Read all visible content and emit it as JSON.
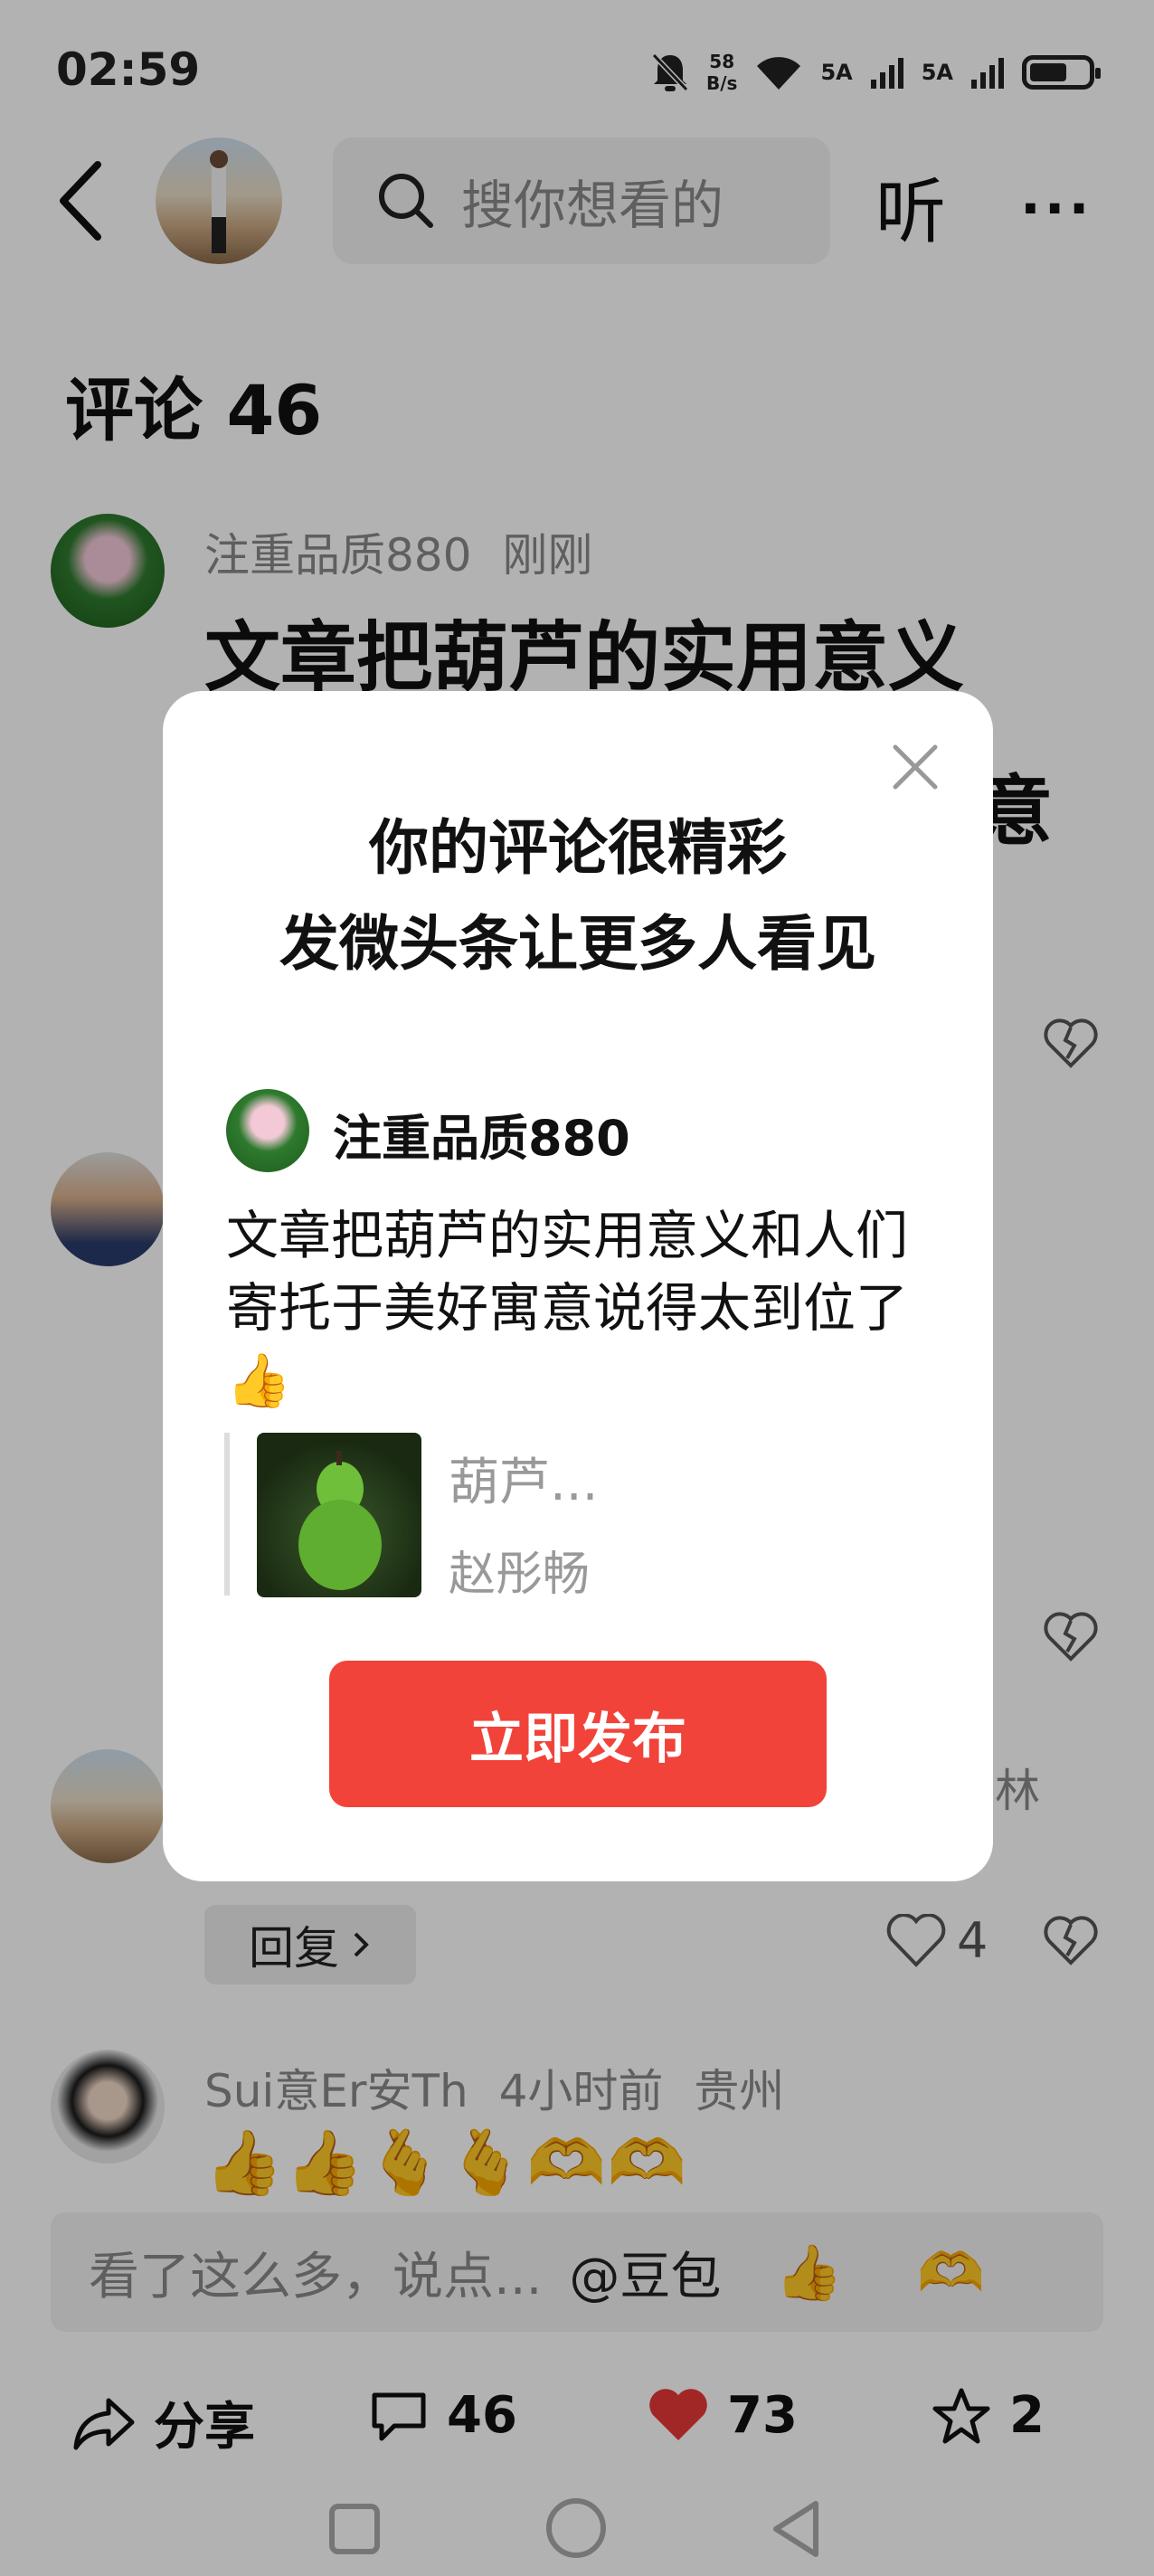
{
  "status_bar": {
    "time": "02:59",
    "net_speed_value": "58",
    "net_speed_unit": "B/s",
    "sim1": "5A",
    "sim2": "5A"
  },
  "header": {
    "search_placeholder": "搜你想看的",
    "listen_label": "听",
    "more_label": "···"
  },
  "comments": {
    "title": "评论 46",
    "first": {
      "user": "注重品质880",
      "time": "刚刚",
      "text_line1": "文章把葫芦的实用意义",
      "text_line2_end": "意"
    },
    "third": {
      "reply_label": "回复",
      "like_count": "4",
      "meta_end": "林"
    },
    "fourth": {
      "user": "Sui意Er安Th",
      "time": "4小时前",
      "location": "贵州",
      "emojis": "👍👍🫰🫰🫶🫶"
    }
  },
  "input": {
    "placeholder": "看了这么多，说点...",
    "doubao": "@豆包",
    "emoji_a": "👍",
    "emoji_b": "🫶"
  },
  "actions": {
    "share_label": "分享",
    "comment_count": "46",
    "like_count": "73",
    "fav_count": "2"
  },
  "modal": {
    "title_line1": "你的评论很精彩",
    "title_line2": "发微头条让更多人看见",
    "user": "注重品质880",
    "body": "文章把葫芦的实用意义和人们寄托于美好寓意说得太到位了👍",
    "quote_title": "葫芦...",
    "quote_author": "赵彤畅",
    "publish_label": "立即发布"
  },
  "colors": {
    "accent": "#f1433a",
    "like_red": "#e53935"
  }
}
